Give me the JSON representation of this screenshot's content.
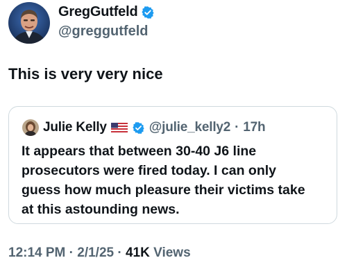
{
  "tweet": {
    "author": {
      "display_name": "GregGutfeld",
      "handle": "@greggutfeld",
      "verified_icon": "verified-badge-icon"
    },
    "text": "This is very very nice",
    "quoted_tweet": {
      "author": {
        "display_name": "Julie Kelly",
        "flag": "🇺🇸",
        "verified_icon": "verified-badge-icon",
        "handle": "@julie_kelly2",
        "separator": "·",
        "age": "17h"
      },
      "lines": [
        "It appears that between 30-40 J6 line",
        "prosecutors were fired today. I can only",
        "guess how much pleasure their victims take",
        "at this astounding news."
      ]
    },
    "footer": {
      "time": "12:14 PM",
      "date": "2/1/25",
      "views_count": "41K",
      "views_label": "Views",
      "separator": "·"
    }
  },
  "colors": {
    "text_primary": "#0f1419",
    "text_secondary": "#536471",
    "verified_blue": "#1d9bf0",
    "card_border": "#cfd9de"
  }
}
